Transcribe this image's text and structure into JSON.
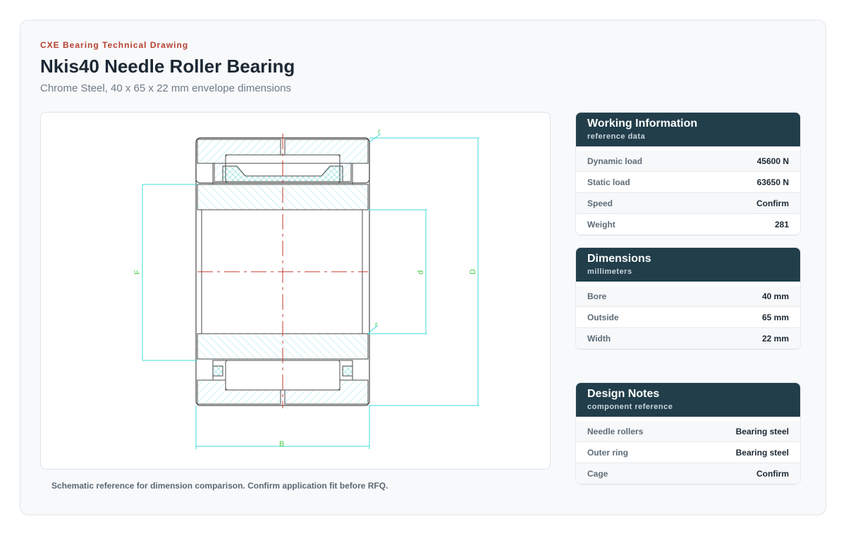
{
  "header": {
    "brand": "CXE Bearing Technical Drawing",
    "title": "Nkis40 Needle Roller Bearing",
    "subtitle": "Chrome Steel, 40 x 65 x 22 mm envelope dimensions"
  },
  "drawing": {
    "labels": {
      "F": "F",
      "d": "d",
      "D": "D",
      "B": "B",
      "r_top": "r",
      "r_inner": "r"
    },
    "colors": {
      "outline": "#4a4a4a",
      "dimension": "#3fd8d8",
      "label": "#4cc94c",
      "centerline": "#c0392b"
    }
  },
  "caption": "Schematic reference for dimension comparison. Confirm application fit before RFQ.",
  "panels": [
    {
      "title": "Working Information",
      "subtitle": "reference data",
      "rows": [
        {
          "label": "Dynamic load",
          "value": "45600 N"
        },
        {
          "label": "Static load",
          "value": "63650 N"
        },
        {
          "label": "Speed",
          "value": "Confirm"
        },
        {
          "label": "Weight",
          "value": "281"
        }
      ]
    },
    {
      "title": "Dimensions",
      "subtitle": "millimeters",
      "rows": [
        {
          "label": "Bore",
          "value": "40 mm"
        },
        {
          "label": "Outside",
          "value": "65 mm"
        },
        {
          "label": "Width",
          "value": "22 mm"
        }
      ]
    },
    {
      "title": "Design Notes",
      "subtitle": "component reference",
      "rows": [
        {
          "label": "Needle rollers",
          "value": "Bearing steel"
        },
        {
          "label": "Outer ring",
          "value": "Bearing steel"
        },
        {
          "label": "Cage",
          "value": "Confirm"
        }
      ]
    }
  ]
}
